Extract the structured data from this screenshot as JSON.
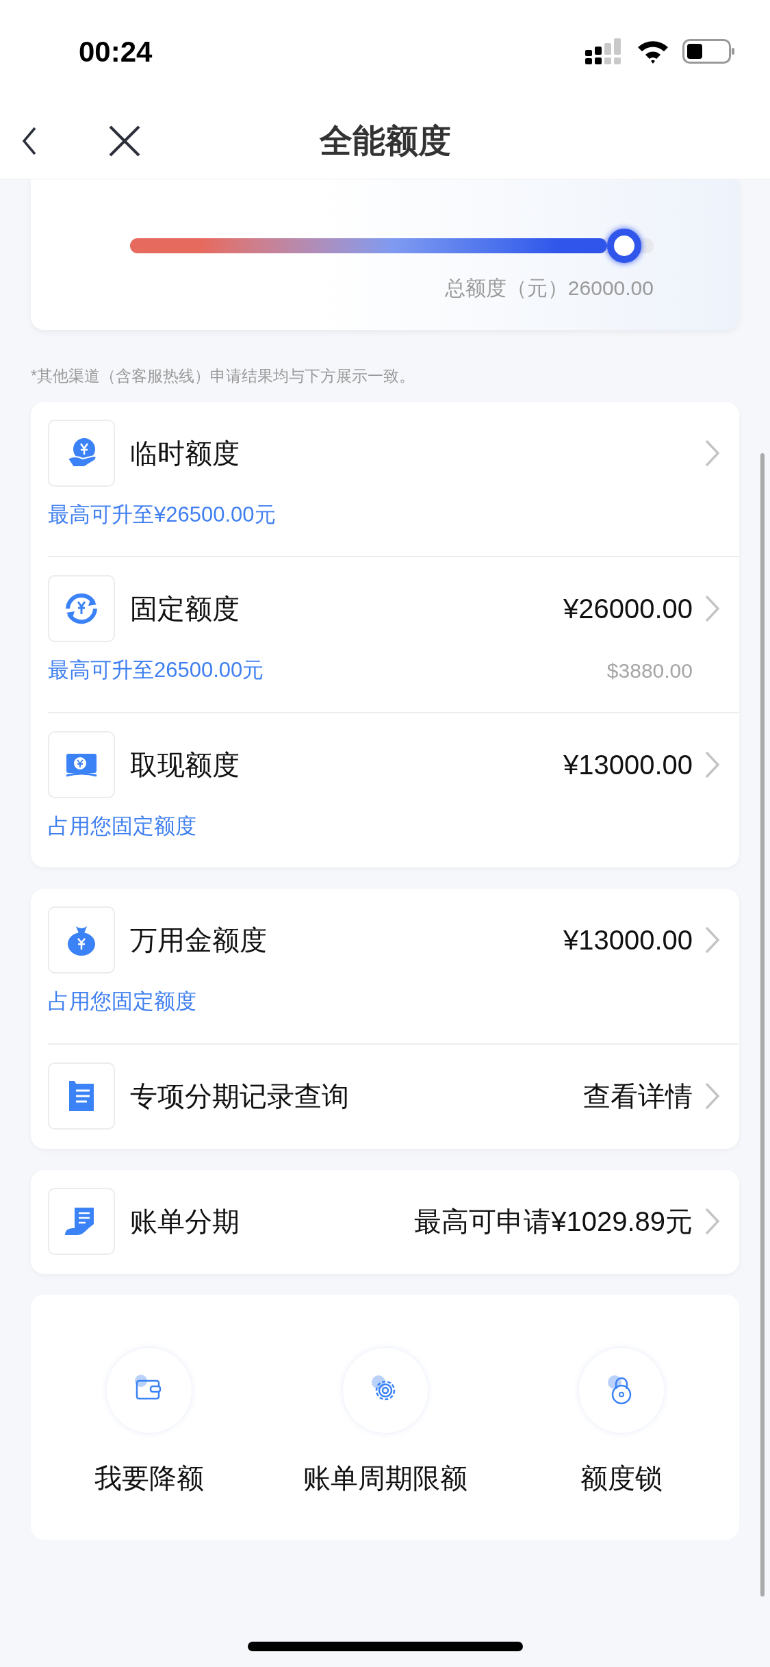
{
  "status_bar": {
    "time": "00:24"
  },
  "nav": {
    "title": "全能额度"
  },
  "total_card": {
    "slider": {
      "level": 0.94
    },
    "total_label": "总额度（元）26000.00"
  },
  "note": "*其他渠道（含客服热线）申请结果均与下方展示一致。",
  "groups": [
    {
      "rows": [
        {
          "title": "临时额度",
          "subtitle": "最高可升至¥26500.00元"
        },
        {
          "title": "固定额度",
          "value": "¥26000.00",
          "subtitle": "最高可升至26500.00元",
          "secondary": "$3880.00"
        },
        {
          "title": "取现额度",
          "value": "¥13000.00",
          "subtitle": "占用您固定额度"
        }
      ]
    },
    {
      "rows": [
        {
          "title": "万用金额度",
          "value": "¥13000.00",
          "subtitle": "占用您固定额度"
        },
        {
          "title": "专项分期记录查询",
          "value": "查看详情"
        }
      ]
    },
    {
      "rows": [
        {
          "title": "账单分期",
          "value": "最高可申请¥1029.89元"
        }
      ]
    }
  ],
  "actions": [
    {
      "label": "我要降额"
    },
    {
      "label": "账单周期限额"
    },
    {
      "label": "额度锁"
    }
  ]
}
